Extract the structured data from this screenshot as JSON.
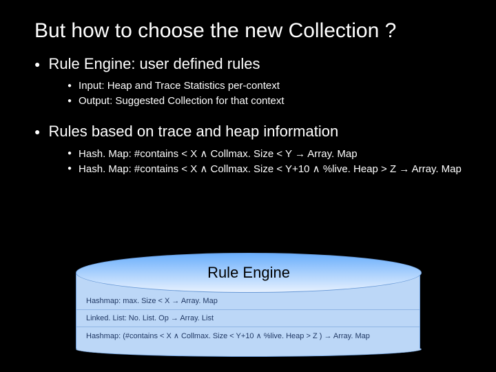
{
  "title": "But how to choose the new Collection ?",
  "bullets": [
    {
      "text": "Rule Engine: user defined rules",
      "sub": [
        "Input: Heap and Trace Statistics per-context",
        "Output: Suggested Collection for that context"
      ]
    },
    {
      "text": "Rules based on trace and heap information",
      "sub": [
        "Hash. Map: #contains < X ∧ Collmax. Size < Y → Array. Map",
        "Hash. Map: #contains < X ∧ Collmax. Size < Y+10 ∧ %live. Heap > Z → Array. Map"
      ]
    }
  ],
  "engine": {
    "title": "Rule Engine",
    "rules": [
      "Hashmap: max. Size < X → Array. Map",
      "Linked. List: No. List. Op → Array. List",
      "Hashmap: (#contains < X ∧ Collmax. Size < Y+10 ∧ %live. Heap > Z ) → Array. Map"
    ]
  }
}
